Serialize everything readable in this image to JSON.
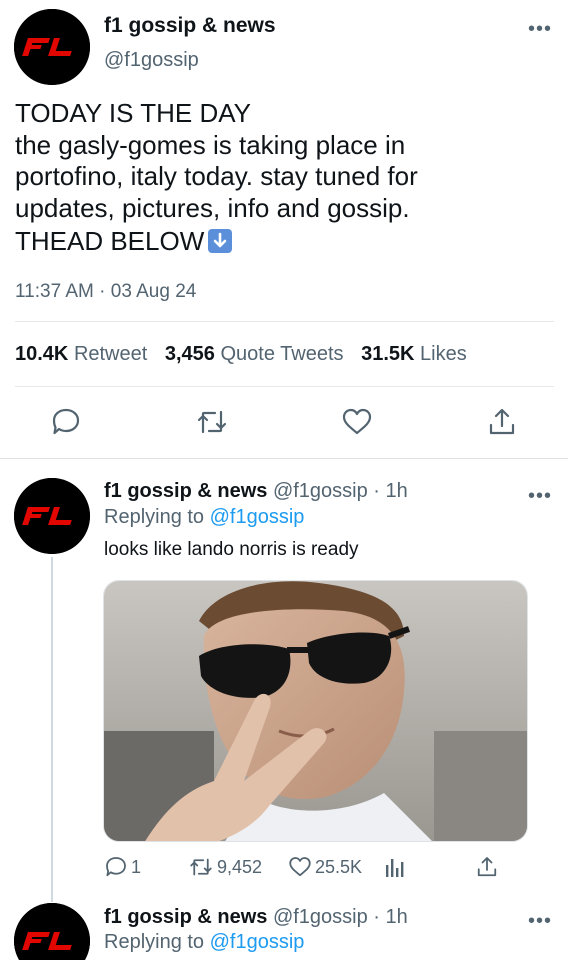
{
  "main_tweet": {
    "author_name": "f1 gossip & news",
    "author_handle": "@f1gossip",
    "avatar_icon": "f1-logo-icon",
    "text_lines": [
      "TODAY IS THE DAY",
      "the gasly-gomes is taking place in",
      "portofino, italy today. stay tuned for",
      "updates, pictures, info and gossip.",
      "THEAD BELOW"
    ],
    "text_emoji": "down-arrow-emoji",
    "timestamp": "11:37 AM · 03 Aug 24",
    "stats": {
      "retweets_value": "10.4K",
      "retweets_label": "Retweet",
      "quotes_value": "3,456",
      "quotes_label": "Quote Tweets",
      "likes_value": "31.5K",
      "likes_label": "Likes"
    },
    "actions": [
      "reply-icon",
      "retweet-icon",
      "like-icon",
      "share-icon"
    ]
  },
  "replies": [
    {
      "author_name": "f1 gossip & news",
      "handle_time": "@f1gossip · 1h",
      "replying_prefix": "Replying to",
      "replying_to": "@f1gossip",
      "text": "looks like lando norris is ready",
      "photo_icon": "selfie-photo",
      "reply_count": "1",
      "retweet_count": "9,452",
      "like_count": "25.5K"
    },
    {
      "author_name": "f1 gossip & news",
      "handle_time": "@f1gossip · 1h",
      "replying_prefix": "Replying to",
      "replying_to": "@f1gossip"
    }
  ],
  "colors": {
    "link": "#1d9bf0",
    "secondary_text": "#536471",
    "logo_red": "#e10600"
  }
}
